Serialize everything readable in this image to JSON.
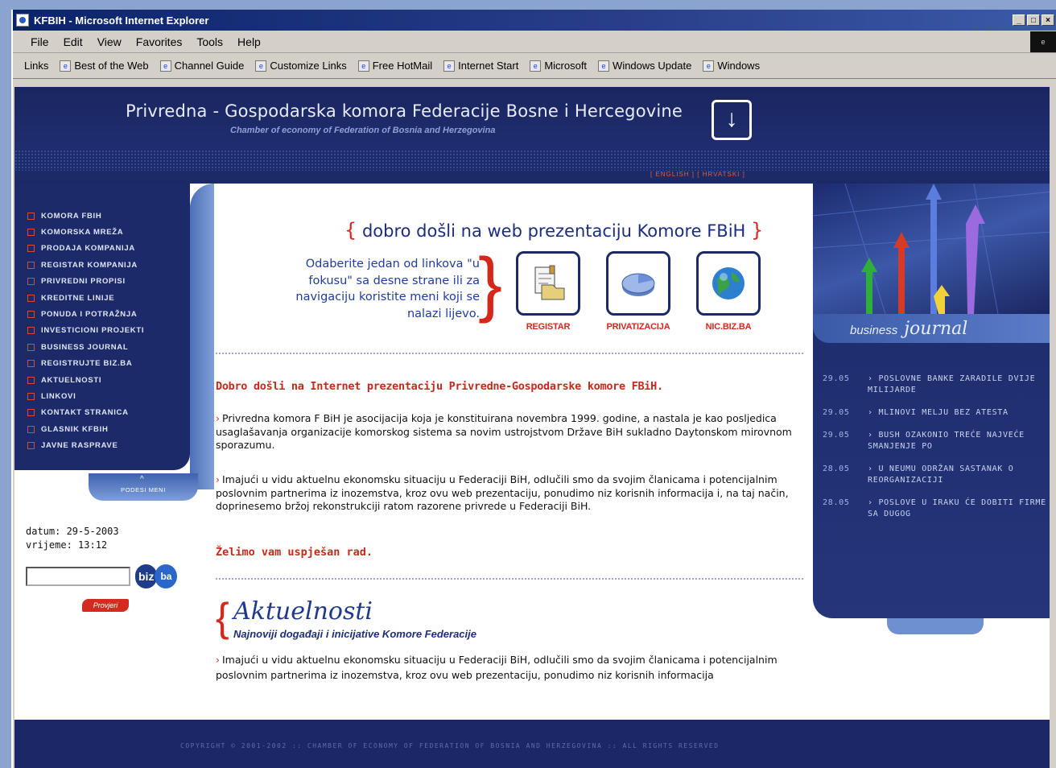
{
  "window": {
    "title": "KFBIH - Microsoft Internet Explorer",
    "controls": [
      "_",
      "□",
      "×"
    ]
  },
  "menubar": [
    "File",
    "Edit",
    "View",
    "Favorites",
    "Tools",
    "Help"
  ],
  "links_bar": {
    "label": "Links",
    "items": [
      "Best of the Web",
      "Channel Guide",
      "Customize Links",
      "Free HotMail",
      "Internet Start",
      "Microsoft",
      "Windows Update",
      "Windows"
    ]
  },
  "header": {
    "title": "Privredna - Gospodarska komora Federacije Bosne i Hercegovine",
    "subtitle": "Chamber of economy of Federation of Bosnia and Herzegovina",
    "lang_english": "[ ENGLISH ]",
    "lang_hrvatski": "[ HRVATSKI ]"
  },
  "leftnav": {
    "items": [
      "KOMORA FBIH",
      "KOMORSKA MREŽA",
      "PRODAJA KOMPANIJA",
      "REGISTAR KOMPANIJA",
      "PRIVREDNI PROPISI",
      "KREDITNE LINIJE",
      "PONUDA I POTRAŽNJA",
      "INVESTICIONI PROJEKTI",
      "BUSINESS JOURNAL",
      "REGISTRUJTE BIZ.BA",
      "AKTUELNOSTI",
      "LINKOVI",
      "KONTAKT STRANICA",
      "GLASNIK KFBIH",
      "JAVNE RASPRAVE"
    ],
    "settings": "PODESI MENI",
    "date_label": "datum: 29-5-2003",
    "time_label": "vrijeme: 13:12",
    "biz": "biz",
    "ba": "ba",
    "search_button": "Provjeri"
  },
  "main": {
    "welcome": "dobro došli na web prezentaciju Komore FBiH",
    "intro": "Odaberite jedan od linkova \"u fokusu\" sa desne strane ili za navigaciju koristite meni koji se nalazi lijevo.",
    "focus": [
      {
        "label": "REGISTAR",
        "icon": "document-folder-icon"
      },
      {
        "label": "PRIVATIZACIJA",
        "icon": "pie-chart-icon"
      },
      {
        "label": "NIC.BIZ.BA",
        "icon": "globe-icon"
      }
    ],
    "title": "Dobro došli na Internet prezentaciju Privredne-Gospodarske komore FBiH.",
    "p1": "Privredna komora F BiH je asocijacija koja je konstituirana novembra 1999. godine, a nastala je kao posljedica usaglašavanja organizacije komorskog sistema sa novim ustrojstvom Države BiH sukladno Daytonskom mirovnom sporazumu.",
    "p2": "Imajući u vidu aktuelnu ekonomsku situaciju u Federaciji BiH, odlučili smo da svojim članicama i potencijalnim poslovnim partnerima iz inozemstva, kroz ovu web prezentaciju, ponudimo niz korisnih informacija i, na taj način, doprinesemo bržoj rekonstrukciji ratom razorene privrede u Federaciji BiH.",
    "wish": "Želimo vam uspješan rad.",
    "news_title": "Aktuelnosti",
    "news_subtitle": "Najnoviji događaji i inicijative Komore Federacije",
    "p3": "Imajući u vidu aktuelnu ekonomsku situaciju u Federaciji BiH, odlučili smo da svojim članicama i potencijalnim poslovnim partnerima iz inozemstva, kroz ovu web prezentaciju, ponudimo niz korisnih informacija"
  },
  "journal": {
    "business": "business",
    "journal": "journal",
    "items": [
      {
        "date": "29.05",
        "text": "POSLOVNE BANKE ZARADILE DVIJE MILIJARDE"
      },
      {
        "date": "29.05",
        "text": "MLINOVI MELJU BEZ ATESTA"
      },
      {
        "date": "29.05",
        "text": "BUSH OZAKONIO TREĆE NAJVEĆE SMANJENJE PO"
      },
      {
        "date": "28.05",
        "text": "U NEUMU ODRŽAN SASTANAK O REORGANIZACIJI"
      },
      {
        "date": "28.05",
        "text": "POSLOVE U IRAKU ĆE DOBITI FIRME SA DUGOG"
      }
    ]
  },
  "footer": {
    "copyright": "COPYRIGHT © 2001-2002 :: CHAMBER OF ECONOMY OF FEDERATION OF BOSNIA AND HERZEGOVINA :: ALL RIGHTS RESERVED"
  }
}
